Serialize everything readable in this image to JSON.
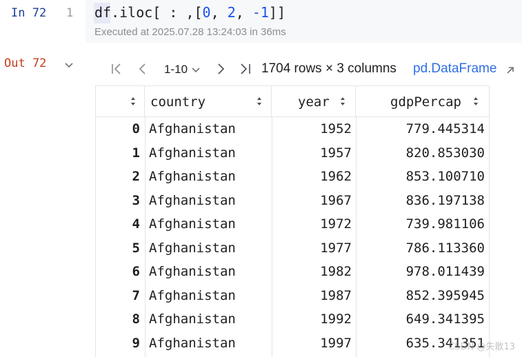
{
  "input_cell": {
    "label": "In 72",
    "line_number": "1",
    "code_prefix": "df.iloc[ : ,[",
    "code_n0": "0",
    "code_sep1": ", ",
    "code_n1": "2",
    "code_sep2": ", ",
    "code_n2": "-1",
    "code_suffix": "]]",
    "executed": "Executed at 2025.07.28 13:24:03 in 36ms"
  },
  "output_cell": {
    "label": "Out 72",
    "pager": {
      "range": "1-10",
      "info": "1704 rows × 3 columns",
      "type_link": "pd.DataFrame"
    },
    "table": {
      "columns": [
        "country",
        "year",
        "gdpPercap"
      ],
      "rows": [
        {
          "index": "0",
          "country": "Afghanistan",
          "year": "1952",
          "gdpPercap": "779.445314"
        },
        {
          "index": "1",
          "country": "Afghanistan",
          "year": "1957",
          "gdpPercap": "820.853030"
        },
        {
          "index": "2",
          "country": "Afghanistan",
          "year": "1962",
          "gdpPercap": "853.100710"
        },
        {
          "index": "3",
          "country": "Afghanistan",
          "year": "1967",
          "gdpPercap": "836.197138"
        },
        {
          "index": "4",
          "country": "Afghanistan",
          "year": "1972",
          "gdpPercap": "739.981106"
        },
        {
          "index": "5",
          "country": "Afghanistan",
          "year": "1977",
          "gdpPercap": "786.113360"
        },
        {
          "index": "6",
          "country": "Afghanistan",
          "year": "1982",
          "gdpPercap": "978.011439"
        },
        {
          "index": "7",
          "country": "Afghanistan",
          "year": "1987",
          "gdpPercap": "852.395945"
        },
        {
          "index": "8",
          "country": "Afghanistan",
          "year": "1992",
          "gdpPercap": "649.341395"
        },
        {
          "index": "9",
          "country": "Afghanistan",
          "year": "1997",
          "gdpPercap": "635.341351"
        }
      ]
    }
  },
  "watermark": "CSDN @失散13",
  "colors": {
    "in_label": "#1f3d9c",
    "out_label": "#c43e1c",
    "number_literal": "#1750eb",
    "link": "#2f6fe4",
    "grid": "#e3e4e8",
    "code_bg": "#f7f8fa"
  },
  "icons": {
    "first_page": "first-page-icon",
    "prev_page": "prev-page-icon",
    "next_page": "next-page-icon",
    "last_page": "last-page-icon",
    "range_dropdown": "chevron-down-icon",
    "collapse": "chevron-down-icon",
    "external_link": "external-link-icon",
    "sort": "sort-icon"
  }
}
